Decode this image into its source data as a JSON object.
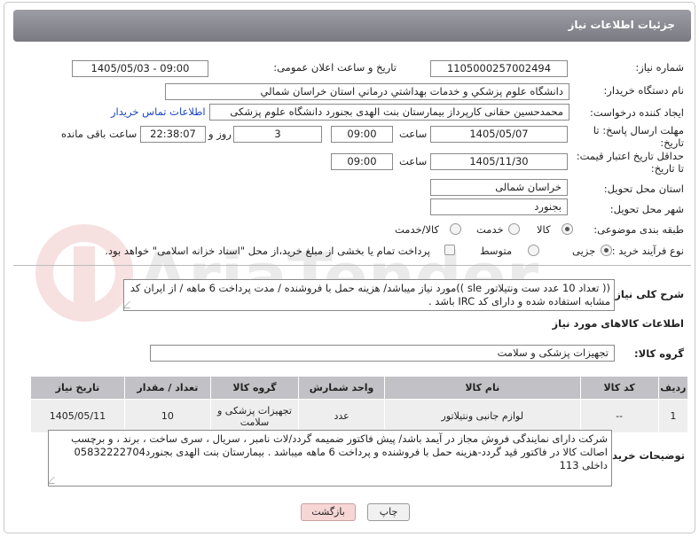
{
  "header": {
    "title": "جزئیات اطلاعات نیاز"
  },
  "form": {
    "need_number_label": "شماره نیاز:",
    "need_number": "1105000257002494",
    "announce_label": "تاریخ و ساعت اعلان عمومی:",
    "announce_value": "1405/05/03 - 09:00",
    "buyer_org_label": "نام دستگاه خریدار:",
    "buyer_org": "دانشگاه علوم پزشکي و خدمات بهداشتي درماني استان خراسان شمالي",
    "requester_label": "ایجاد کننده درخواست:",
    "requester": "محمدحسین حقانی کارپرداز بیمارستان بنت الهدی بجنورد دانشگاه علوم پزشکی",
    "contact_link": "اطلاعات تماس خریدار",
    "deadline_label_1": "مهلت ارسال پاسخ: تا",
    "deadline_label_2": "تاریخ:",
    "deadline_date": "1405/05/07",
    "time_label": "ساعت",
    "deadline_time": "09:00",
    "days_value": "3",
    "days_label": "روز و",
    "remaining_time": "22:38:07",
    "remaining_label": "ساعت باقی مانده",
    "validity_label_1": "حداقل تاریخ اعتبار قیمت:",
    "validity_label_2": "تا تاریخ:",
    "validity_date": "1405/11/30",
    "validity_time": "09:00",
    "province_label": "استان محل تحویل:",
    "province": "خراسان شمالی",
    "city_label": "شهر محل تحویل:",
    "city": "بجنورد",
    "category_label": "طبقه بندی موضوعی:",
    "category_options": [
      "کالا",
      "خدمت",
      "کالا/خدمت"
    ],
    "category_selected": "کالا",
    "process_label": "نوع فرآیند خرید :",
    "process_options": [
      "جزیی",
      "متوسط"
    ],
    "process_selected": "جزیی",
    "payment_note": "پرداخت تمام یا بخشی از مبلغ خرید،از محل \"اسناد خزانه اسلامی\" خواهد بود."
  },
  "description": {
    "label": "شرح کلی نیاز:",
    "text": "(( تعداد 10 عدد ست ونتیلاتور sle ))مورد نیاز میباشد/ هزینه حمل با فروشنده  / مدت پرداخت 6 ماهه / از ایران کد مشابه استفاده شده و دارای کد IRC باشد ."
  },
  "goods": {
    "section_title": "اطلاعات کالاهای مورد نیاز",
    "group_label": "گروه کالا:",
    "group_value": "تجهیزات پزشکی و سلامت",
    "columns": [
      "ردیف",
      "کد کالا",
      "نام کالا",
      "واحد شمارش",
      "گروه کالا",
      "تعداد / مقدار",
      "تاریخ نیاز"
    ],
    "rows": [
      [
        "1",
        "--",
        "لوازم جانبی ونتیلاتور",
        "عدد",
        "تجهیزات پزشکی و سلامت",
        "10",
        "1405/05/11"
      ]
    ]
  },
  "buyer_notes": {
    "label": "توضیحات خریدار:",
    "text": "شرکت دارای نمایندگی فروش مجاز در آیمد باشد/ پیش فاکتور ضمیمه گردد/لات نامبر ، سریال ، سری ساخت ، برند ، و برچسب اصالت کالا در فاکتور قید گردد-هزینه حمل با فروشنده و پرداخت 6 ماهه میباشد . بیمارستان بنت الهدی بجنورد05832222704 داخلی 113"
  },
  "buttons": {
    "print": "چاپ",
    "back": "بازگشت"
  },
  "watermark": {
    "text": "AriaTender.neT"
  },
  "colors": {
    "link": "#1a44c8",
    "titlebar": "#8a8a92",
    "back_button": "#f7d6d6",
    "print_button": "#f1f1f1"
  }
}
